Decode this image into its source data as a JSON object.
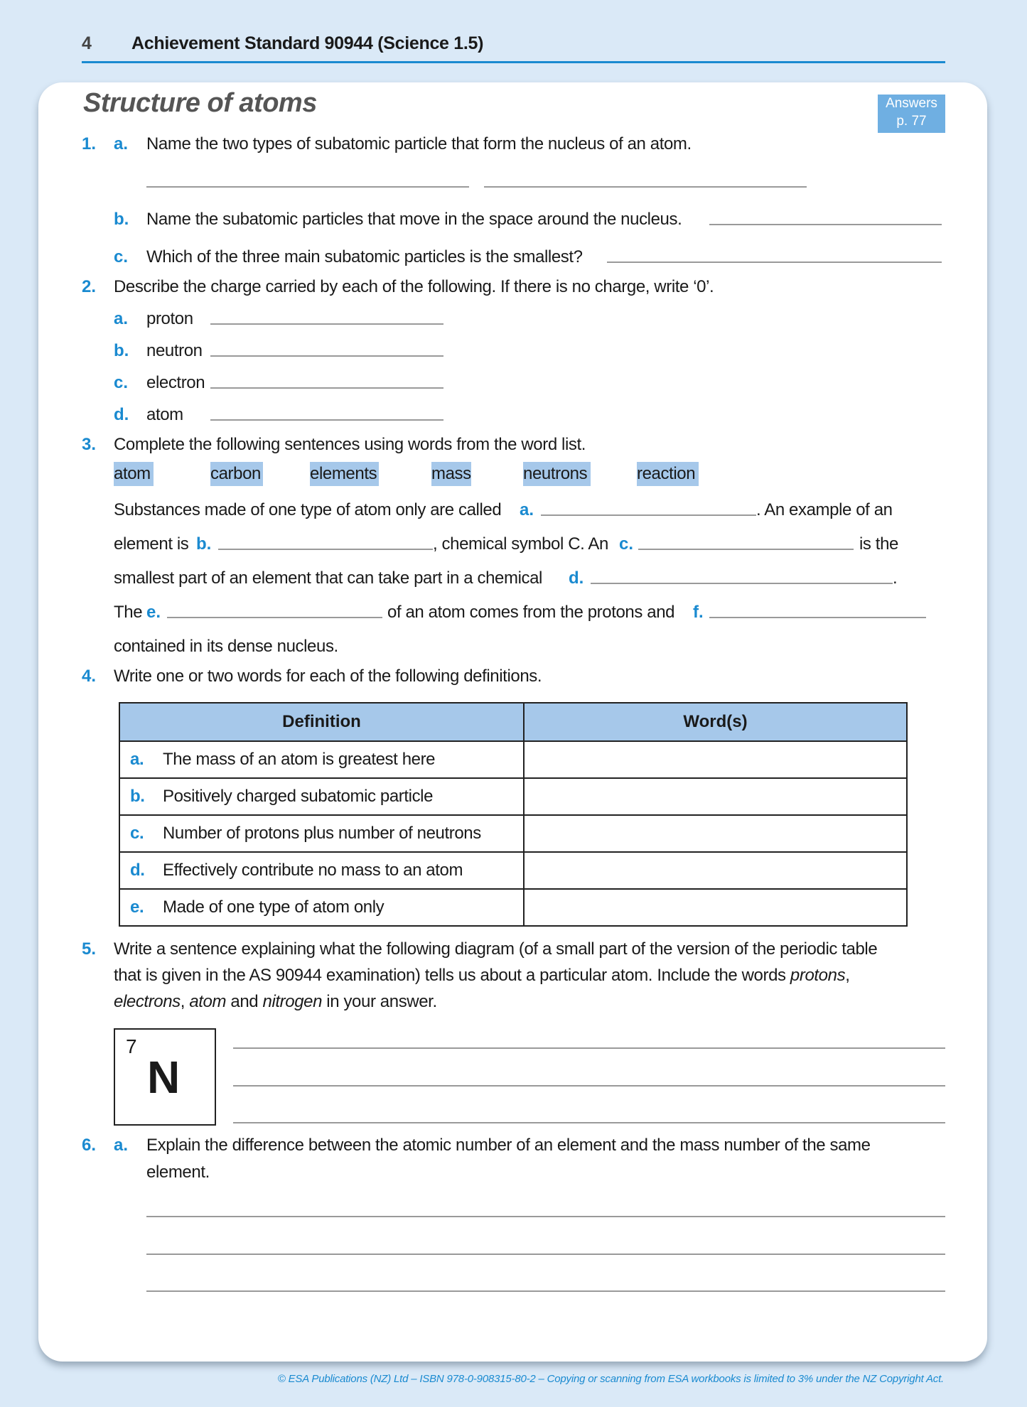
{
  "header": {
    "page_number": "4",
    "standard": "Achievement Standard 90944 (Science 1.5)"
  },
  "title": "Structure of atoms",
  "answers_badge": {
    "line1": "Answers",
    "line2": "p. 77"
  },
  "colors": {
    "accent_blue": "#1a8ad0",
    "highlight_blue": "#a6c8ea",
    "badge_blue": "#6fafe2",
    "background": "#dae9f7"
  },
  "q1": {
    "number": "1.",
    "a": {
      "label": "a.",
      "text": "Name the two types of subatomic particle that form the nucleus of an atom."
    },
    "b": {
      "label": "b.",
      "text": "Name the subatomic particles that move in the space around the nucleus."
    },
    "c": {
      "label": "c.",
      "text": "Which of the three main subatomic particles is the smallest?"
    }
  },
  "q2": {
    "number": "2.",
    "text": "Describe the charge carried by each of the following. If there is no charge, write ‘0’.",
    "items": [
      {
        "label": "a.",
        "text": "proton"
      },
      {
        "label": "b.",
        "text": "neutron"
      },
      {
        "label": "c.",
        "text": "electron"
      },
      {
        "label": "d.",
        "text": "atom"
      }
    ]
  },
  "q3": {
    "number": "3.",
    "text": "Complete the following sentences using words from the word list.",
    "word_list": [
      "atom",
      "carbon",
      "elements",
      "mass",
      "neutrons",
      "reaction"
    ],
    "p1a": "Substances made of one type of atom only are called",
    "p1b": ". An example of an",
    "p2a": "element is",
    "p2b": ", chemical symbol C. An",
    "p2c": "is the",
    "p3a": "smallest part of an element that can take part in a chemical",
    "p3b": ".",
    "p4a": "The",
    "p4b": "of an atom comes from the protons and",
    "p5": "contained in its dense nucleus.",
    "labels": {
      "a": "a.",
      "b": "b.",
      "c": "c.",
      "d": "d.",
      "e": "e.",
      "f": "f."
    }
  },
  "q4": {
    "number": "4.",
    "text": "Write one or two words for each of the following definitions.",
    "columns": [
      "Definition",
      "Word(s)"
    ],
    "rows": [
      {
        "label": "a.",
        "definition": "The mass of an atom is greatest here",
        "answer": ""
      },
      {
        "label": "b.",
        "definition": "Positively charged subatomic particle",
        "answer": ""
      },
      {
        "label": "c.",
        "definition": "Number of protons plus number of neutrons",
        "answer": ""
      },
      {
        "label": "d.",
        "definition": "Effectively contribute no mass to an atom",
        "answer": ""
      },
      {
        "label": "e.",
        "definition": "Made of one type of atom only",
        "answer": ""
      }
    ]
  },
  "q5": {
    "number": "5.",
    "line1": "Write a sentence explaining what the following diagram (of a small part of the version of the periodic table",
    "line2a": "that is given in the AS 90944 examination) tells us about a particular atom. Include the words ",
    "w_protons": "protons",
    "comma": ",",
    "w_electrons": "electrons",
    "sep1": ", ",
    "w_atom": "atom",
    "and": " and ",
    "w_nitrogen": "nitrogen",
    "tail": " in your answer.",
    "element": {
      "atomic_number": "7",
      "symbol": "N"
    }
  },
  "q6": {
    "number": "6.",
    "a": {
      "label": "a.",
      "line1": "Explain the difference between the atomic number of an element and the mass number of the same",
      "line2": "element."
    }
  },
  "footer": "© ESA Publications (NZ) Ltd  –  ISBN 978-0-908315-80-2 –  Copying or scanning from ESA workbooks is limited to 3% under the NZ Copyright Act."
}
